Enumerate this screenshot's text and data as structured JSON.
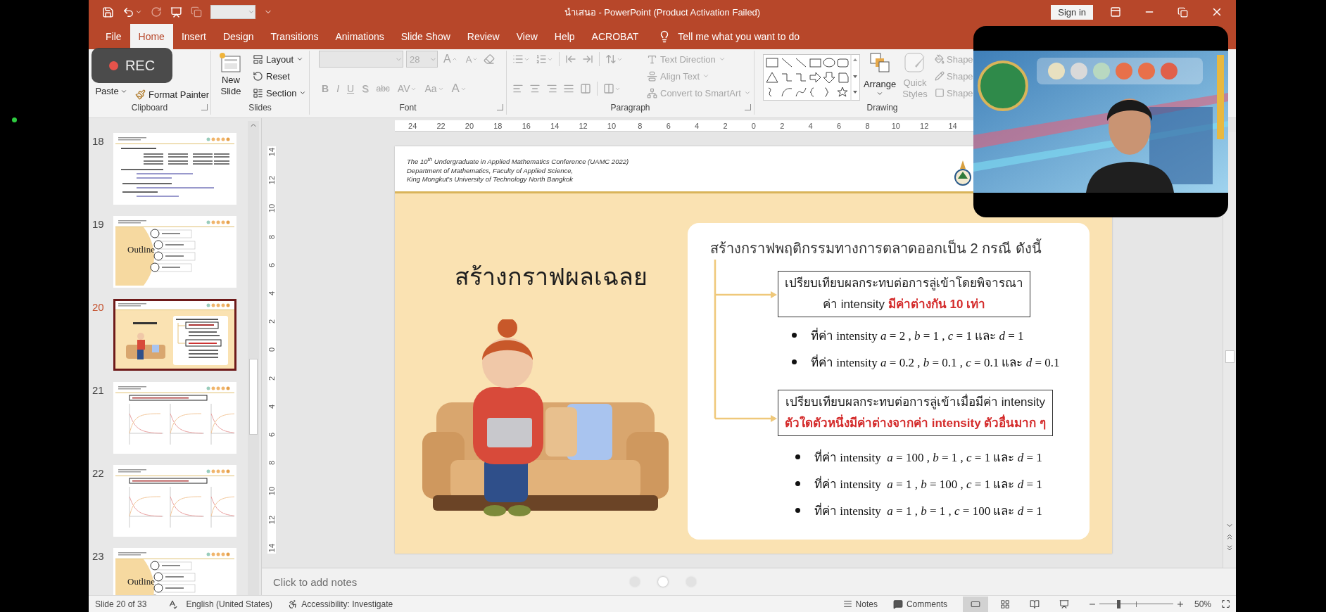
{
  "window": {
    "title": "นำเสนอ - PowerPoint (Product Activation Failed)",
    "sign_in": "Sign in"
  },
  "tabs": [
    {
      "label": "File",
      "selected": false
    },
    {
      "label": "Home",
      "selected": true
    },
    {
      "label": "Insert",
      "selected": false
    },
    {
      "label": "Design",
      "selected": false
    },
    {
      "label": "Transitions",
      "selected": false
    },
    {
      "label": "Animations",
      "selected": false
    },
    {
      "label": "Slide Show",
      "selected": false
    },
    {
      "label": "Review",
      "selected": false
    },
    {
      "label": "View",
      "selected": false
    },
    {
      "label": "Help",
      "selected": false
    },
    {
      "label": "ACROBAT",
      "selected": false
    }
  ],
  "search": {
    "placeholder": "Tell me what you want to do"
  },
  "recording": {
    "label": "REC"
  },
  "ribbon": {
    "groups": [
      {
        "kind": "clipboard",
        "label": "Clipboard",
        "buttons": [
          {
            "kind": "large",
            "label": "Paste",
            "disabled": false
          },
          {
            "kind": "small",
            "label": "Format Painter",
            "disabled": false
          }
        ]
      },
      {
        "kind": "slides",
        "label": "Slides",
        "buttons": [
          {
            "kind": "large",
            "label": "New Slide",
            "disabled": false
          },
          {
            "kind": "small",
            "label": "Layout",
            "disabled": false
          },
          {
            "kind": "small",
            "label": "Reset",
            "disabled": false
          },
          {
            "kind": "small",
            "label": "Section",
            "disabled": false
          }
        ]
      },
      {
        "kind": "font",
        "label": "Font",
        "fields": [
          {
            "kind": "name"
          },
          {
            "kind": "size",
            "value": "28"
          }
        ],
        "buttons": [
          {
            "kind": "grow",
            "label": "A",
            "disabled": true
          },
          {
            "kind": "shrink",
            "label": "A",
            "disabled": true
          },
          {
            "kind": "bold",
            "label": "B",
            "disabled": true
          },
          {
            "kind": "italic",
            "label": "I",
            "disabled": true
          },
          {
            "kind": "underline",
            "label": "U",
            "disabled": true
          },
          {
            "kind": "shadow",
            "label": "S",
            "disabled": true
          },
          {
            "kind": "strike",
            "label": "abc",
            "disabled": true
          },
          {
            "kind": "spacing",
            "label": "AV",
            "disabled": true
          },
          {
            "kind": "case",
            "label": "Aa",
            "disabled": true
          },
          {
            "kind": "color",
            "label": "A",
            "disabled": true
          }
        ]
      },
      {
        "kind": "paragraph",
        "label": "Paragraph",
        "buttons": [
          {
            "kind": "small",
            "label": "Text Direction",
            "disabled": true
          },
          {
            "kind": "small",
            "label": "Align Text",
            "disabled": true
          },
          {
            "kind": "small",
            "label": "Convert to SmartArt",
            "disabled": true
          }
        ]
      },
      {
        "kind": "drawing",
        "label": "Drawing",
        "buttons": [
          {
            "kind": "large",
            "label": "Arrange",
            "disabled": false
          },
          {
            "kind": "large",
            "label": "Quick Styles",
            "disabled": true
          },
          {
            "kind": "small",
            "label": "Shape",
            "disabled": true
          },
          {
            "kind": "small",
            "label": "Shape",
            "disabled": true
          },
          {
            "kind": "small",
            "label": "Shape",
            "disabled": true
          }
        ]
      }
    ]
  },
  "slides_panel": {
    "thumbnails": [
      {
        "number": "18",
        "kind": "text",
        "selected": false
      },
      {
        "number": "19",
        "kind": "outline",
        "label": "Outline",
        "selected": false
      },
      {
        "number": "20",
        "kind": "current",
        "selected": true
      },
      {
        "number": "21",
        "kind": "chart",
        "selected": false
      },
      {
        "number": "22",
        "kind": "chart",
        "selected": false
      },
      {
        "number": "23",
        "kind": "outline",
        "label": "Outline",
        "selected": false
      }
    ]
  },
  "rulers": {
    "horizontal": [
      "24",
      "22",
      "20",
      "18",
      "16",
      "14",
      "12",
      "10",
      "8",
      "6",
      "4",
      "2",
      "0",
      "2",
      "4",
      "6",
      "8",
      "10",
      "12",
      "14"
    ],
    "vertical": [
      "14",
      "12",
      "10",
      "8",
      "6",
      "4",
      "2",
      "0",
      "2",
      "4",
      "6",
      "8",
      "10",
      "12",
      "14"
    ]
  },
  "slide": {
    "header": [
      "The 10$^{th}$ Undergraduate in Applied Mathematics Conference (UAMC 2022)",
      "Department of Mathematics, Faculty of Applied Science,",
      "King Mongkut’s University of Technology North Bangkok"
    ],
    "title": "สร้างกราฟผลเฉลย",
    "illustration": {
      "kind": "picture"
    },
    "card": {
      "heading": "สร้างกราฟพฤติกรรมทางการตลาดออกเป็น 2 กรณี ดังนี้",
      "cases": [
        {
          "box": [
            {
              "text": "เปรียบเทียบผลกระทบต่อการลู่เข้าโดยพิจารณา",
              "emphasis": false
            },
            {
              "text": "ค่า intensity **มีค่าต่างกัน 10 เท่า**",
              "emphasis": false
            }
          ],
          "bullets": [
            "ที่ค่า intensity *a* = 2 , *b* = 1 , *c* = 1 และ *d* = 1",
            "ที่ค่า intensity *a* = 0.2 , *b* = 0.1 , *c* = 0.1 และ *d* = 0.1"
          ]
        },
        {
          "box": [
            {
              "text": "เปรียบเทียบผลกระทบต่อการลู่เข้าเมื่อมีค่า intensity",
              "emphasis": false
            },
            {
              "text": "ตัวใดตัวหนึ่งมีค่าต่างจากค่า intensity ตัวอื่นมาก ๆ",
              "emphasis": true
            }
          ],
          "bullets": [
            "ที่ค่า intensity  *a* = 100 , *b* = 1 , *c* = 1 และ *d* = 1",
            "ที่ค่า intensity  *a* = 1 , *b* = 100 , *c* = 1 และ *d* = 1",
            "ที่ค่า intensity  *a* = 1 , *b* = 1 , *c* = 100 และ *d* = 1"
          ]
        }
      ]
    }
  },
  "notes": {
    "placeholder": "Click to add notes"
  },
  "pager": [
    {
      "selected": false
    },
    {
      "selected": true
    },
    {
      "selected": false
    }
  ],
  "video": {
    "kind": "picture"
  },
  "status_bar": {
    "slide": "Slide 20 of 33",
    "language": "English (United States)",
    "accessibility": "Accessibility: Investigate",
    "notes": "Notes",
    "comments": "Comments",
    "views": [
      {
        "kind": "normal",
        "selected": true
      },
      {
        "kind": "sorter",
        "selected": false
      },
      {
        "kind": "reading",
        "selected": false
      },
      {
        "kind": "show",
        "selected": false
      }
    ],
    "zoom": {
      "level": 0.26,
      "reading": "50%"
    }
  }
}
